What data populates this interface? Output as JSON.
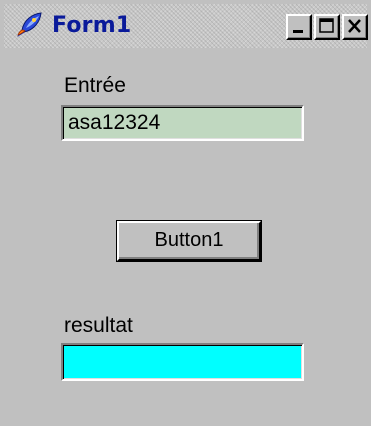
{
  "window": {
    "title": "Form1",
    "icon": "delphi-app-icon",
    "controls": {
      "minimize_icon": "minimize-icon",
      "maximize_icon": "maximize-icon",
      "close_icon": "close-icon"
    }
  },
  "form": {
    "input_label": "Entrée",
    "input_value": "asa12324",
    "button_label": "Button1",
    "result_label": "resultat",
    "result_value": ""
  },
  "colors": {
    "title_text": "#0a1a9a",
    "background": "#c0c0c0",
    "input_background": "#c0d8c0",
    "result_background": "#00ffff"
  }
}
